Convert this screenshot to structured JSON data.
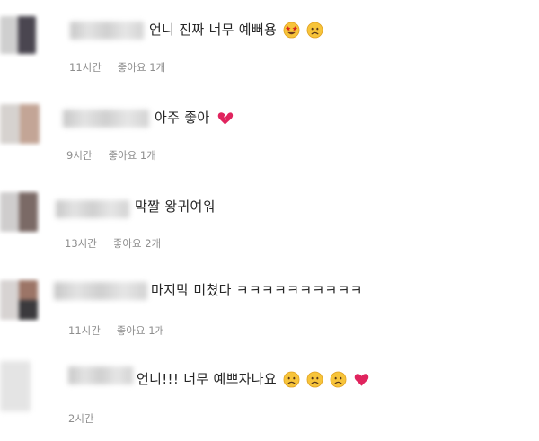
{
  "comments": [
    {
      "text": "언니 진짜 너무 예뻐용",
      "time": "11시간",
      "likes": "좋아요 1개",
      "emojis": [
        "star-struck-icon",
        "sad-face-icon"
      ]
    },
    {
      "text": "아주 좋아",
      "time": "9시간",
      "likes": "좋아요 1개",
      "emojis": [
        "broken-heart-icon"
      ]
    },
    {
      "text": "막짤 왕귀여워",
      "time": "13시간",
      "likes": "좋아요 2개",
      "emojis": []
    },
    {
      "text": "마지막 미쳤다 ㅋㅋㅋㅋㅋㅋㅋㅋㅋㅋ",
      "time": "11시간",
      "likes": "좋아요 1개",
      "emojis": []
    },
    {
      "text": "언니!!! 너무 예쁘자나요",
      "time": "2시간",
      "likes": "",
      "emojis": [
        "sad-face-icon",
        "sad-face-icon",
        "sad-face-icon",
        "red-heart-icon"
      ]
    }
  ],
  "colors": {
    "text": "#262626",
    "meta": "#8e8e8e",
    "emoji_face": "#f7c43a",
    "heart": "#e0245e"
  }
}
